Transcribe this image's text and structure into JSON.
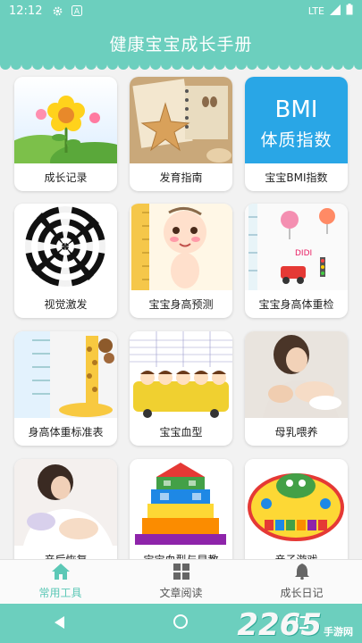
{
  "status_bar": {
    "time": "12:12",
    "network": "LTE"
  },
  "app_bar": {
    "title": "健康宝宝成长手册"
  },
  "thumbs": {
    "bmi_line1": "BMI",
    "bmi_line2": "体质指数"
  },
  "cards": [
    {
      "label": "成长记录"
    },
    {
      "label": "发育指南"
    },
    {
      "label": "宝宝BMI指数"
    },
    {
      "label": "视觉激发"
    },
    {
      "label": "宝宝身高预测"
    },
    {
      "label": "宝宝身高体重检"
    },
    {
      "label": "身高体重标准表"
    },
    {
      "label": "宝宝血型"
    },
    {
      "label": "母乳喂养"
    },
    {
      "label": "产后恢复"
    },
    {
      "label": "宝宝血型与早教"
    },
    {
      "label": "亲子游戏"
    }
  ],
  "bottom_nav": [
    {
      "label": "常用工具",
      "icon": "home-icon",
      "active": true
    },
    {
      "label": "文章阅读",
      "icon": "grid-icon",
      "active": false
    },
    {
      "label": "成长日记",
      "icon": "bell-icon",
      "active": false
    }
  ],
  "watermark": {
    "brand": "2265",
    "sub": "手游网"
  },
  "colors": {
    "primary": "#6ccfbe",
    "active_nav": "#5cc8b6",
    "bmi_blue": "#29a6e6"
  }
}
